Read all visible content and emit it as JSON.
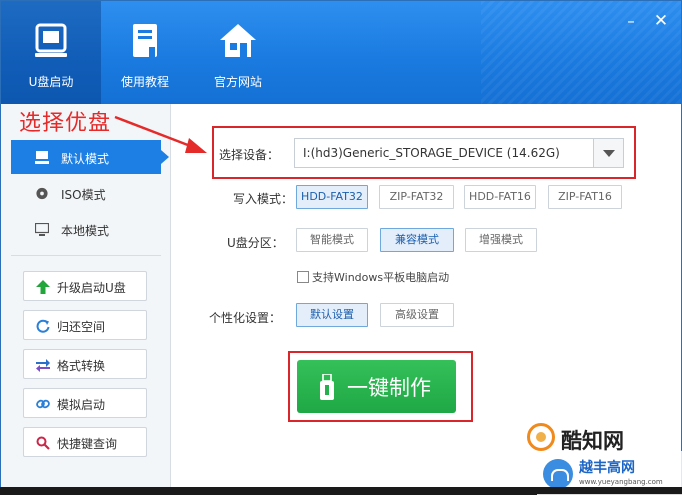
{
  "topnav": {
    "items": [
      {
        "label": "U盘启动",
        "icon": "usb-drive-icon"
      },
      {
        "label": "使用教程",
        "icon": "book-icon"
      },
      {
        "label": "官方网站",
        "icon": "home-icon"
      }
    ],
    "minimize": "–",
    "close": "✕"
  },
  "annotation": "选择优盘",
  "sidebar": {
    "modes": [
      {
        "label": "默认模式",
        "icon": "computer-icon"
      },
      {
        "label": "ISO模式",
        "icon": "disc-icon"
      },
      {
        "label": "本地模式",
        "icon": "monitor-icon"
      }
    ],
    "tools": [
      {
        "label": "升级启动U盘",
        "icon": "arrow-up-icon"
      },
      {
        "label": "归还空间",
        "icon": "refresh-icon"
      },
      {
        "label": "格式转换",
        "icon": "swap-icon"
      },
      {
        "label": "模拟启动",
        "icon": "link-icon"
      },
      {
        "label": "快捷键查询",
        "icon": "search-icon"
      }
    ]
  },
  "form": {
    "device_label": "选择设备：",
    "device_value": "I:(hd3)Generic_STORAGE_DEVICE (14.62G)",
    "write_label": "写入模式：",
    "write_options": [
      "HDD-FAT32",
      "ZIP-FAT32",
      "HDD-FAT16",
      "ZIP-FAT16"
    ],
    "write_selected": "HDD-FAT32",
    "partition_label": "U盘分区：",
    "partition_options": [
      "智能模式",
      "兼容模式",
      "增强模式"
    ],
    "partition_selected": "兼容模式",
    "checkbox_label": "支持Windows平板电脑启动",
    "checkbox_checked": false,
    "personal_label": "个性化设置：",
    "personal_options": [
      "默认设置",
      "高级设置"
    ],
    "personal_selected": "默认设置",
    "make_button": "一键制作"
  },
  "watermarks": {
    "primary": "酷知网",
    "secondary": "越丰高网",
    "secondary_url": "www.yueyangbang.com"
  },
  "colors": {
    "accent_blue": "#1d7fe3",
    "make_green": "#25b04d",
    "annotation_red": "#e52a2a"
  }
}
